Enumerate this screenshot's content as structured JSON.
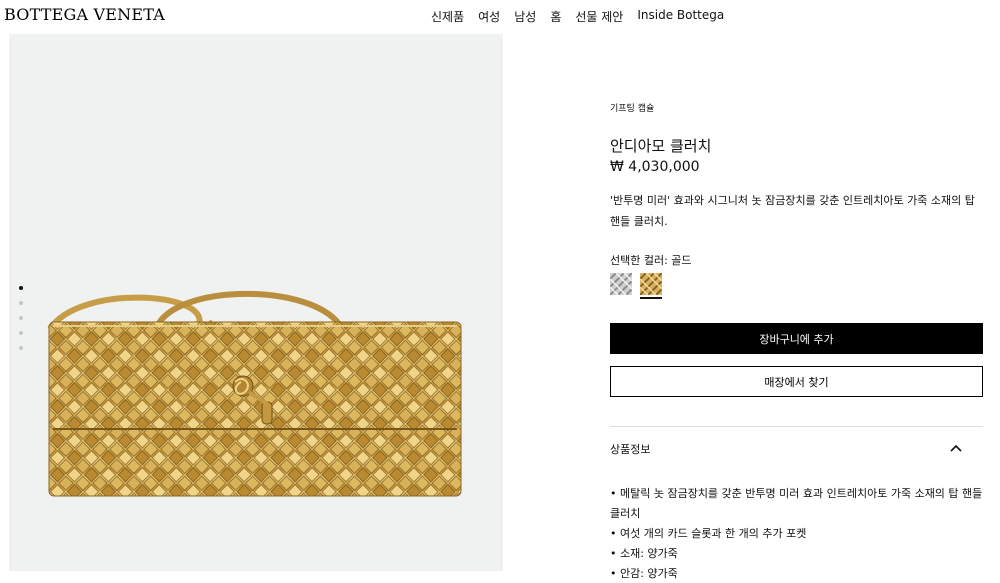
{
  "header": {
    "logo": "BOTTEGA VENETA",
    "nav": [
      "신제품",
      "여성",
      "남성",
      "홈",
      "선물 제안",
      "Inside Bottega"
    ]
  },
  "gallery": {
    "image_alt": "gold woven clutch",
    "dot_count": 5,
    "active_dot": 0
  },
  "product": {
    "category": "기프팅 캡슐",
    "title": "안디아모 클러치",
    "price": "₩ 4,030,000",
    "description": "'반투명 미러' 효과와 시그니처 놋 잠금장치를 갖춘 인트레치아토 가죽 소재의 탑 핸들 클러치.",
    "color_label": "선택한 컬러: 골드",
    "swatches": [
      {
        "name": "silver",
        "color": "#b9b9b9"
      },
      {
        "name": "gold",
        "color": "#c9a14a"
      }
    ],
    "selected_swatch": "gold",
    "add_to_cart": "장바구니에 추가",
    "find_in_store": "매장에서 찾기"
  },
  "product_info": {
    "title": "상품정보",
    "details": [
      "• 메탈릭 놋 잠금장치를 갖춘 반투명 미러 효과 인트레치아토 가죽 소재의 탑 핸들 클러치",
      "• 여섯 개의 카드 슬롯과 한 개의 추가 포켓",
      "• 소재: 양가죽",
      "• 안감: 양가죽"
    ]
  },
  "colors": {
    "accent": "#000000",
    "gold": "#c9a14a",
    "panel_bg": "#f0f2f2"
  }
}
